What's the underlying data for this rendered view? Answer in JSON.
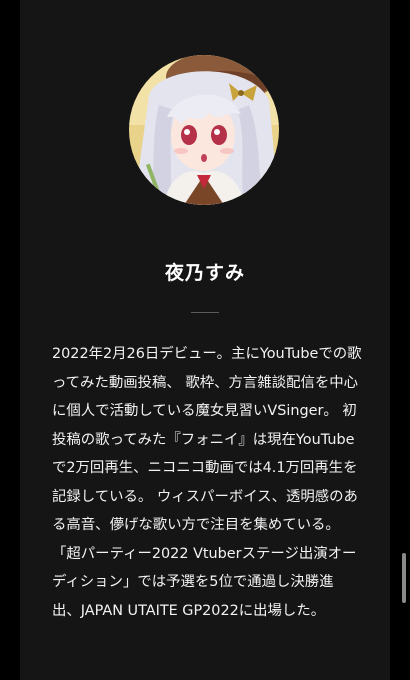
{
  "profile": {
    "name": "夜乃すみ",
    "bio": "2022年2月26日デビュー。主にYouTubeでの歌ってみた動画投稿、 歌枠、方言雑談配信を中心に個人で活動している魔女見習いVSinger。 初投稿の歌ってみた『フォニイ』は現在YouTubeで2万回再生、ニコニコ動画では4.1万回再生を記録している。 ウィスパーボイス、透明感のある高音、儚げな歌い方で注目を集めている。 「超パーティー2022 Vtuberステージ出演オーディション」では予選を5位で通過し決勝進出、JAPAN UTAITE GP2022に出場した。"
  },
  "colors": {
    "background": "#000000",
    "panel": "#151515",
    "text": "#f2f2f2"
  }
}
